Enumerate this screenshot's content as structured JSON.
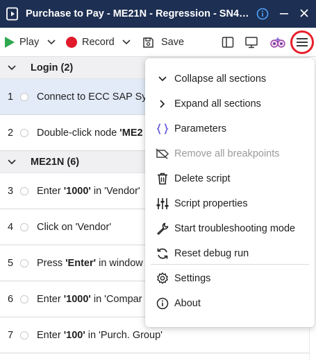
{
  "window": {
    "title": "Purchase to Pay - ME21N - Regression - SN4…"
  },
  "toolbar": {
    "play_label": "Play",
    "record_label": "Record",
    "save_label": "Save"
  },
  "sections": [
    {
      "label": "Login  (2)"
    },
    {
      "label": "ME21N (6)"
    }
  ],
  "steps": [
    {
      "num": "1",
      "pre": "Connect to ECC SAP Sy",
      "bold": "",
      "post": ""
    },
    {
      "num": "2",
      "pre": "Double-click node ",
      "bold": "'ME2",
      "post": ""
    },
    {
      "num": "3",
      "pre": "Enter ",
      "bold": "'1000'",
      "post": " in 'Vendor'"
    },
    {
      "num": "4",
      "pre": "Click on 'Vendor'",
      "bold": "",
      "post": ""
    },
    {
      "num": "5",
      "pre": "Press ",
      "bold": "'Enter'",
      "post": " in window"
    },
    {
      "num": "6",
      "pre": "Enter ",
      "bold": "'1000'",
      "post": " in 'Compar"
    },
    {
      "num": "7",
      "pre": "Enter ",
      "bold": "'100'",
      "post": " in 'Purch. Group'"
    }
  ],
  "menu": {
    "items": [
      {
        "label": "Collapse all sections",
        "icon": "chevron-down-icon",
        "disabled": false
      },
      {
        "label": "Expand all sections",
        "icon": "chevron-right-icon",
        "disabled": false
      },
      {
        "label": "Parameters",
        "icon": "braces-icon",
        "disabled": false
      },
      {
        "label": "Remove all breakpoints",
        "icon": "breakpoint-off-icon",
        "disabled": true
      },
      {
        "label": "Delete script",
        "icon": "trash-icon",
        "disabled": false
      },
      {
        "label": "Script properties",
        "icon": "sliders-icon",
        "disabled": false
      },
      {
        "label": "Start troubleshooting mode",
        "icon": "wrench-icon",
        "disabled": false
      },
      {
        "label": "Reset debug run",
        "icon": "refresh-icon",
        "disabled": false
      },
      {
        "label": "Settings",
        "icon": "gear-icon",
        "disabled": false
      },
      {
        "label": "About",
        "icon": "info-icon",
        "disabled": false
      }
    ]
  },
  "colors": {
    "titlebar": "#1d2f52",
    "record": "#e0192b",
    "play": "#2fa84f",
    "highlight_ring": "#e8202c",
    "selected_row": "#e3ebf8",
    "parameters_icon": "#5a4fd6"
  }
}
